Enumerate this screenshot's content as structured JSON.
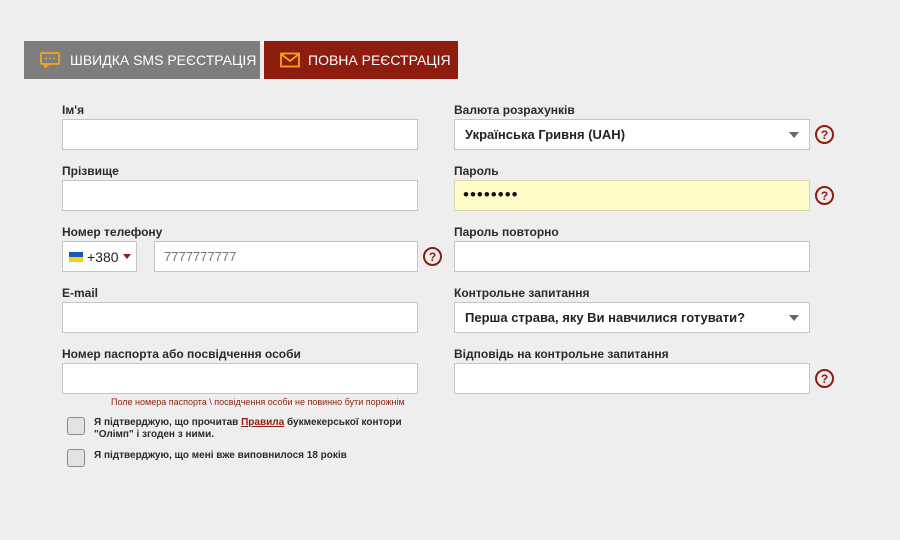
{
  "tabs": {
    "sms_label": "Швидка SMS реєстрація",
    "full_label": "Повна реєстрація",
    "sms_icon": "chat-bubble-icon",
    "full_icon": "envelope-icon"
  },
  "left": {
    "first_name_label": "Ім'я",
    "first_name_value": "",
    "last_name_label": "Прізвище",
    "last_name_value": "",
    "phone_label": "Номер телефону",
    "phone_code": "+380",
    "phone_placeholder": "7777777777",
    "email_label": "E-mail",
    "email_value": "",
    "passport_label": "Номер паспорта або посвідчення особи",
    "passport_value": "",
    "passport_error": "Поле номера паспорта \\ посвідчення особи не повинно бути порожнім"
  },
  "right": {
    "currency_label": "Валюта розрахунків",
    "currency_value": "Українська Гривня (UAH)",
    "password_label": "Пароль",
    "password_value": "••••••••",
    "password_repeat_label": "Пароль повторно",
    "password_repeat_value": "",
    "security_question_label": "Контрольне запитання",
    "security_question_value": "Перша страва, яку Ви навчилися готувати?",
    "security_answer_label": "Відповідь на контрольне запитання",
    "security_answer_value": ""
  },
  "help_symbol": "?",
  "checks": {
    "rules_prefix": "Я підтверджую, що прочитав",
    "rules_link": "Правила",
    "rules_suffix": "букмекерської контори",
    "rules_line2": "\"Олімп\" і згоден з ними.",
    "age_text": "Я підтверджую, що мені вже виповнилося 18 років"
  },
  "colors": {
    "accent": "#8e1c0f",
    "tab_inactive": "#7d7d7d",
    "icon_orange": "#f2a71b",
    "password_bg": "#fefcc9"
  }
}
